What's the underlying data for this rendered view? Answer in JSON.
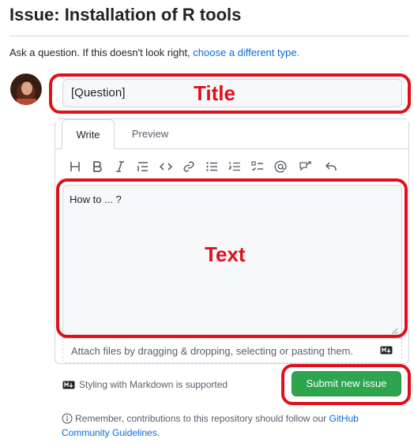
{
  "page": {
    "title": "Issue: Installation of R tools",
    "intro_text": "Ask a question. If this doesn't look right, ",
    "intro_link": "choose a different type."
  },
  "form": {
    "title_value": "[Question]",
    "tabs": [
      {
        "label": "Write",
        "active": true
      },
      {
        "label": "Preview",
        "active": false
      }
    ],
    "toolbar": [
      {
        "name": "heading-icon"
      },
      {
        "name": "bold-icon"
      },
      {
        "name": "italic-icon"
      },
      {
        "name": "quote-icon"
      },
      {
        "name": "code-icon"
      },
      {
        "name": "link-icon"
      },
      {
        "name": "bulleted-list-icon"
      },
      {
        "name": "numbered-list-icon"
      },
      {
        "name": "task-list-icon"
      },
      {
        "name": "mention-icon"
      },
      {
        "name": "cross-reference-icon"
      },
      {
        "name": "reply-icon"
      }
    ],
    "body_value": "How to ... ?",
    "attach_text": "Attach files by dragging & dropping, selecting or pasting them.",
    "markdown_note": "Styling with Markdown is supported",
    "submit_label": "Submit new issue"
  },
  "annotations": {
    "title_label": "Title",
    "text_label": "Text",
    "color": "#e0101a"
  },
  "footer": {
    "text": "Remember, contributions to this repository should follow our ",
    "link": "GitHub Community Guidelines",
    "suffix": "."
  },
  "colors": {
    "accent_link": "#0969da",
    "submit_green": "#2da44e",
    "border": "#d0d7de"
  }
}
